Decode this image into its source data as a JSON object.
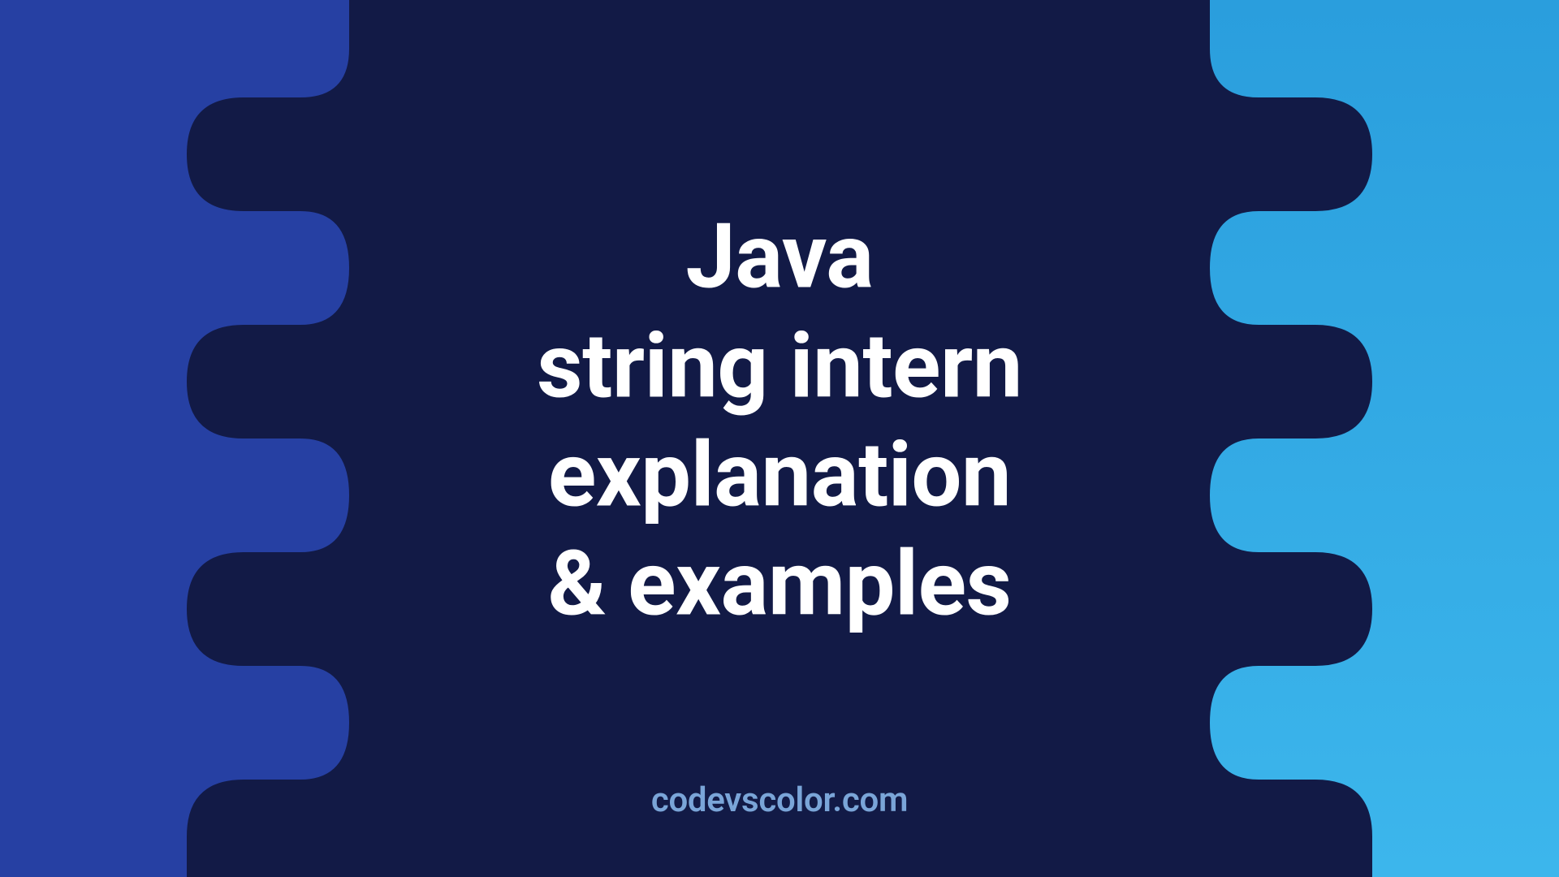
{
  "title": {
    "line1": "Java",
    "line2": "string intern",
    "line3": "explanation",
    "line4": "& examples"
  },
  "credit": "codevscolor.com",
  "colors": {
    "left_bg": "#2640a3",
    "right_bg_top": "#2a9edd",
    "right_bg_bottom": "#3cb6ec",
    "center_blob": "#121a46",
    "title_text": "#ffffff",
    "credit_text": "#7aa5d8"
  }
}
